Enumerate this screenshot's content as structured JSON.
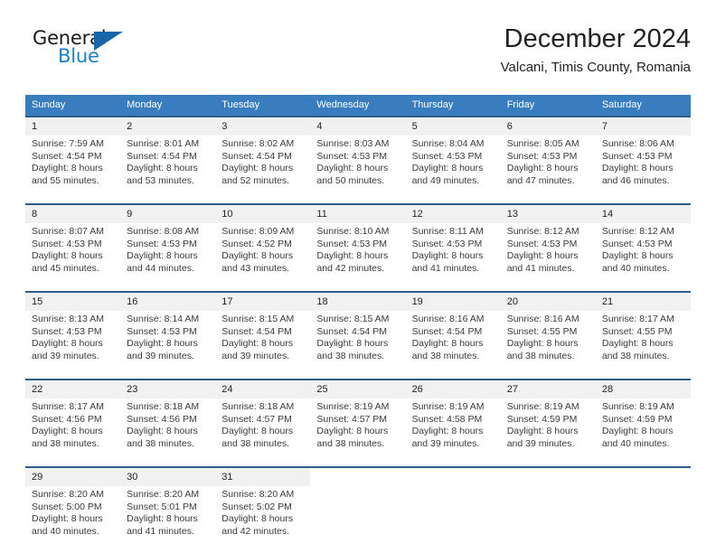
{
  "logo": {
    "word_top": "General",
    "word_bottom": "Blue",
    "accent_color": "#1767a8",
    "text_color": "#1a1a1a",
    "blue_text_color": "#1f7fc4"
  },
  "header": {
    "title": "December 2024",
    "subtitle": "Valcani, Timis County, Romania"
  },
  "calendar": {
    "header_bg": "#3a7dbe",
    "daynum_bg": "#f1f1f1",
    "rule_color": "#2e5d8c",
    "weekdays": [
      "Sunday",
      "Monday",
      "Tuesday",
      "Wednesday",
      "Thursday",
      "Friday",
      "Saturday"
    ],
    "weeks": [
      [
        {
          "day": "1",
          "sunrise": "Sunrise: 7:59 AM",
          "sunset": "Sunset: 4:54 PM",
          "daylight_line1": "Daylight: 8 hours",
          "daylight_line2": "and 55 minutes."
        },
        {
          "day": "2",
          "sunrise": "Sunrise: 8:01 AM",
          "sunset": "Sunset: 4:54 PM",
          "daylight_line1": "Daylight: 8 hours",
          "daylight_line2": "and 53 minutes."
        },
        {
          "day": "3",
          "sunrise": "Sunrise: 8:02 AM",
          "sunset": "Sunset: 4:54 PM",
          "daylight_line1": "Daylight: 8 hours",
          "daylight_line2": "and 52 minutes."
        },
        {
          "day": "4",
          "sunrise": "Sunrise: 8:03 AM",
          "sunset": "Sunset: 4:53 PM",
          "daylight_line1": "Daylight: 8 hours",
          "daylight_line2": "and 50 minutes."
        },
        {
          "day": "5",
          "sunrise": "Sunrise: 8:04 AM",
          "sunset": "Sunset: 4:53 PM",
          "daylight_line1": "Daylight: 8 hours",
          "daylight_line2": "and 49 minutes."
        },
        {
          "day": "6",
          "sunrise": "Sunrise: 8:05 AM",
          "sunset": "Sunset: 4:53 PM",
          "daylight_line1": "Daylight: 8 hours",
          "daylight_line2": "and 47 minutes."
        },
        {
          "day": "7",
          "sunrise": "Sunrise: 8:06 AM",
          "sunset": "Sunset: 4:53 PM",
          "daylight_line1": "Daylight: 8 hours",
          "daylight_line2": "and 46 minutes."
        }
      ],
      [
        {
          "day": "8",
          "sunrise": "Sunrise: 8:07 AM",
          "sunset": "Sunset: 4:53 PM",
          "daylight_line1": "Daylight: 8 hours",
          "daylight_line2": "and 45 minutes."
        },
        {
          "day": "9",
          "sunrise": "Sunrise: 8:08 AM",
          "sunset": "Sunset: 4:53 PM",
          "daylight_line1": "Daylight: 8 hours",
          "daylight_line2": "and 44 minutes."
        },
        {
          "day": "10",
          "sunrise": "Sunrise: 8:09 AM",
          "sunset": "Sunset: 4:52 PM",
          "daylight_line1": "Daylight: 8 hours",
          "daylight_line2": "and 43 minutes."
        },
        {
          "day": "11",
          "sunrise": "Sunrise: 8:10 AM",
          "sunset": "Sunset: 4:53 PM",
          "daylight_line1": "Daylight: 8 hours",
          "daylight_line2": "and 42 minutes."
        },
        {
          "day": "12",
          "sunrise": "Sunrise: 8:11 AM",
          "sunset": "Sunset: 4:53 PM",
          "daylight_line1": "Daylight: 8 hours",
          "daylight_line2": "and 41 minutes."
        },
        {
          "day": "13",
          "sunrise": "Sunrise: 8:12 AM",
          "sunset": "Sunset: 4:53 PM",
          "daylight_line1": "Daylight: 8 hours",
          "daylight_line2": "and 41 minutes."
        },
        {
          "day": "14",
          "sunrise": "Sunrise: 8:12 AM",
          "sunset": "Sunset: 4:53 PM",
          "daylight_line1": "Daylight: 8 hours",
          "daylight_line2": "and 40 minutes."
        }
      ],
      [
        {
          "day": "15",
          "sunrise": "Sunrise: 8:13 AM",
          "sunset": "Sunset: 4:53 PM",
          "daylight_line1": "Daylight: 8 hours",
          "daylight_line2": "and 39 minutes."
        },
        {
          "day": "16",
          "sunrise": "Sunrise: 8:14 AM",
          "sunset": "Sunset: 4:53 PM",
          "daylight_line1": "Daylight: 8 hours",
          "daylight_line2": "and 39 minutes."
        },
        {
          "day": "17",
          "sunrise": "Sunrise: 8:15 AM",
          "sunset": "Sunset: 4:54 PM",
          "daylight_line1": "Daylight: 8 hours",
          "daylight_line2": "and 39 minutes."
        },
        {
          "day": "18",
          "sunrise": "Sunrise: 8:15 AM",
          "sunset": "Sunset: 4:54 PM",
          "daylight_line1": "Daylight: 8 hours",
          "daylight_line2": "and 38 minutes."
        },
        {
          "day": "19",
          "sunrise": "Sunrise: 8:16 AM",
          "sunset": "Sunset: 4:54 PM",
          "daylight_line1": "Daylight: 8 hours",
          "daylight_line2": "and 38 minutes."
        },
        {
          "day": "20",
          "sunrise": "Sunrise: 8:16 AM",
          "sunset": "Sunset: 4:55 PM",
          "daylight_line1": "Daylight: 8 hours",
          "daylight_line2": "and 38 minutes."
        },
        {
          "day": "21",
          "sunrise": "Sunrise: 8:17 AM",
          "sunset": "Sunset: 4:55 PM",
          "daylight_line1": "Daylight: 8 hours",
          "daylight_line2": "and 38 minutes."
        }
      ],
      [
        {
          "day": "22",
          "sunrise": "Sunrise: 8:17 AM",
          "sunset": "Sunset: 4:56 PM",
          "daylight_line1": "Daylight: 8 hours",
          "daylight_line2": "and 38 minutes."
        },
        {
          "day": "23",
          "sunrise": "Sunrise: 8:18 AM",
          "sunset": "Sunset: 4:56 PM",
          "daylight_line1": "Daylight: 8 hours",
          "daylight_line2": "and 38 minutes."
        },
        {
          "day": "24",
          "sunrise": "Sunrise: 8:18 AM",
          "sunset": "Sunset: 4:57 PM",
          "daylight_line1": "Daylight: 8 hours",
          "daylight_line2": "and 38 minutes."
        },
        {
          "day": "25",
          "sunrise": "Sunrise: 8:19 AM",
          "sunset": "Sunset: 4:57 PM",
          "daylight_line1": "Daylight: 8 hours",
          "daylight_line2": "and 38 minutes."
        },
        {
          "day": "26",
          "sunrise": "Sunrise: 8:19 AM",
          "sunset": "Sunset: 4:58 PM",
          "daylight_line1": "Daylight: 8 hours",
          "daylight_line2": "and 39 minutes."
        },
        {
          "day": "27",
          "sunrise": "Sunrise: 8:19 AM",
          "sunset": "Sunset: 4:59 PM",
          "daylight_line1": "Daylight: 8 hours",
          "daylight_line2": "and 39 minutes."
        },
        {
          "day": "28",
          "sunrise": "Sunrise: 8:19 AM",
          "sunset": "Sunset: 4:59 PM",
          "daylight_line1": "Daylight: 8 hours",
          "daylight_line2": "and 40 minutes."
        }
      ],
      [
        {
          "day": "29",
          "sunrise": "Sunrise: 8:20 AM",
          "sunset": "Sunset: 5:00 PM",
          "daylight_line1": "Daylight: 8 hours",
          "daylight_line2": "and 40 minutes."
        },
        {
          "day": "30",
          "sunrise": "Sunrise: 8:20 AM",
          "sunset": "Sunset: 5:01 PM",
          "daylight_line1": "Daylight: 8 hours",
          "daylight_line2": "and 41 minutes."
        },
        {
          "day": "31",
          "sunrise": "Sunrise: 8:20 AM",
          "sunset": "Sunset: 5:02 PM",
          "daylight_line1": "Daylight: 8 hours",
          "daylight_line2": "and 42 minutes."
        },
        {
          "day": "",
          "sunrise": "",
          "sunset": "",
          "daylight_line1": "",
          "daylight_line2": ""
        },
        {
          "day": "",
          "sunrise": "",
          "sunset": "",
          "daylight_line1": "",
          "daylight_line2": ""
        },
        {
          "day": "",
          "sunrise": "",
          "sunset": "",
          "daylight_line1": "",
          "daylight_line2": ""
        },
        {
          "day": "",
          "sunrise": "",
          "sunset": "",
          "daylight_line1": "",
          "daylight_line2": ""
        }
      ]
    ]
  }
}
